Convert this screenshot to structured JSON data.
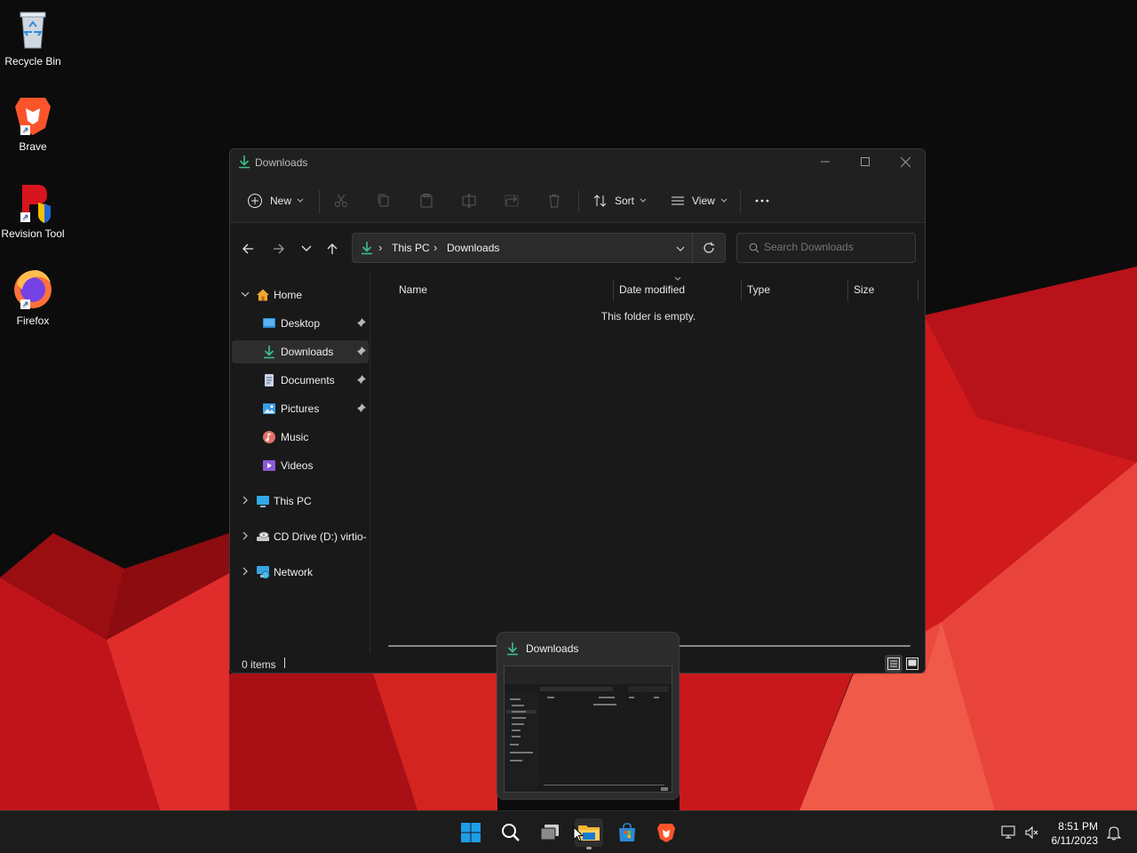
{
  "desktop": {
    "icons": [
      {
        "label": "Recycle Bin",
        "icon": "recycle-bin-icon"
      },
      {
        "label": "Brave",
        "icon": "brave-icon"
      },
      {
        "label": "Revision Tool",
        "icon": "revision-tool-icon"
      },
      {
        "label": "Firefox",
        "icon": "firefox-icon"
      }
    ],
    "wallpaper_colors": {
      "base": "#0c0c0c",
      "red": "#c8141a",
      "red_light": "#e43a36",
      "red_dark": "#7e0a0c"
    }
  },
  "window": {
    "title": "Downloads",
    "toolbar": {
      "new_label": "New",
      "sort_label": "Sort",
      "view_label": "View",
      "more_label": "···"
    },
    "address": {
      "crumbs": [
        "This PC",
        "Downloads"
      ],
      "separator": "›"
    },
    "search": {
      "placeholder": "Search Downloads"
    },
    "sidebar": {
      "home": "Home",
      "items": [
        {
          "label": "Desktop",
          "pinned": true
        },
        {
          "label": "Downloads",
          "pinned": true,
          "selected": true
        },
        {
          "label": "Documents",
          "pinned": true
        },
        {
          "label": "Pictures",
          "pinned": true
        },
        {
          "label": "Music",
          "pinned": false
        },
        {
          "label": "Videos",
          "pinned": false
        }
      ],
      "this_pc": "This PC",
      "cd_drive": "CD Drive (D:) virtio-",
      "network": "Network"
    },
    "columns": [
      "Name",
      "Date modified",
      "Type",
      "Size"
    ],
    "empty_message": "This folder is empty.",
    "status": {
      "item_count": "0 items"
    }
  },
  "preview": {
    "title": "Downloads"
  },
  "taskbar": {
    "apps": [
      "start-icon",
      "search-icon",
      "task-view-icon",
      "file-explorer-icon",
      "microsoft-store-icon",
      "brave-icon"
    ],
    "time": "8:51 PM",
    "date": "6/11/2023",
    "accent": "#0078d4"
  }
}
